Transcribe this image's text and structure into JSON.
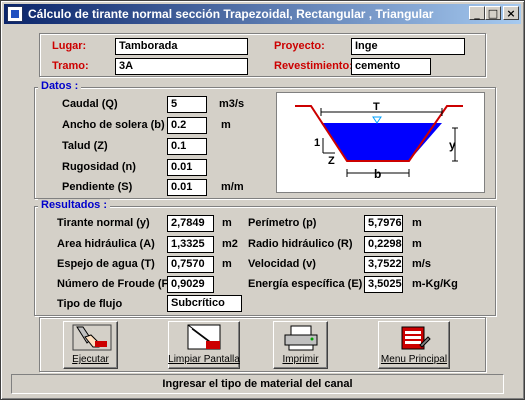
{
  "window": {
    "title": "Cálculo de tirante normal sección Trapezoidal, Rectangular , Triangular",
    "controls": {
      "minimize": "_",
      "maximize": "□",
      "close": "×"
    }
  },
  "header": {
    "lugar_label": "Lugar:",
    "lugar_value": "Tamborada",
    "proyecto_label": "Proyecto:",
    "proyecto_value": "Inge",
    "tramo_label": "Tramo:",
    "tramo_value": "3A",
    "revestimiento_label": "Revestimiento:",
    "revestimiento_value": "cemento"
  },
  "datos": {
    "title": "Datos :",
    "caudal": {
      "label": "Caudal (Q)",
      "value": "5",
      "unit": "m3/s"
    },
    "ancho": {
      "label": "Ancho de solera (b)",
      "value": "0.2",
      "unit": "m"
    },
    "talud": {
      "label": "Talud (Z)",
      "value": "0.1"
    },
    "rugosidad": {
      "label": "Rugosidad (n)",
      "value": "0.01"
    },
    "pendiente": {
      "label": "Pendiente (S)",
      "value": "0.01",
      "unit": "m/m"
    }
  },
  "diagram": {
    "T": "T",
    "y": "y",
    "b": "b",
    "one": "1",
    "Z": "Z"
  },
  "resultados": {
    "title": "Resultados :",
    "tirante": {
      "label": "Tirante normal (y)",
      "value": "2,7849",
      "unit": "m"
    },
    "area": {
      "label": "Area hidráulica (A)",
      "value": "1,3325",
      "unit": "m2"
    },
    "espejo": {
      "label": "Espejo de agua (T)",
      "value": "0,7570",
      "unit": "m"
    },
    "froude": {
      "label": "Número de Froude (F)",
      "value": "0,9029"
    },
    "flujo": {
      "label": "Tipo de flujo",
      "value": "Subcrítico"
    },
    "perimetro": {
      "label": "Perímetro (p)",
      "value": "5,7976",
      "unit": "m"
    },
    "radio": {
      "label": "Radio hidráulico (R)",
      "value": "0,2298",
      "unit": "m"
    },
    "velocidad": {
      "label": "Velocidad (v)",
      "value": "3,7522",
      "unit": "m/s"
    },
    "energia": {
      "label": "Energía específica (E)",
      "value": "3,5025",
      "unit": "m-Kg/Kg"
    }
  },
  "buttons": {
    "ejecutar": "Ejecutar",
    "limpiar": "Limpiar Pantalla",
    "imprimir": "Imprimir",
    "menu": "Menu Principal"
  },
  "status": "Ingresar el tipo de material del canal",
  "colors": {
    "title_start": "#0a246a",
    "label_red": "#cc0000",
    "group_blue": "#0000cc",
    "water": "#0000ff"
  }
}
